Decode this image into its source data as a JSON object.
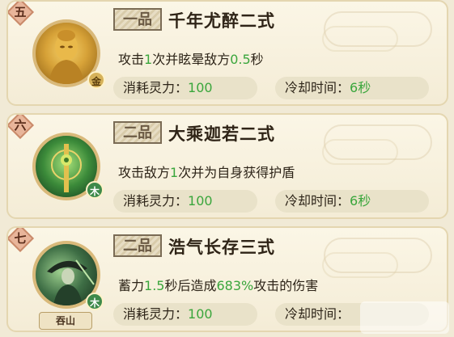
{
  "skills": [
    {
      "index": "五",
      "grade": "一品",
      "name": "千年尤醉二式",
      "desc": {
        "pre": "攻击",
        "v1": "1",
        "mid": "次并眩晕敌方",
        "v2": "0.5",
        "post": "秒"
      },
      "element": "金",
      "cost_label": "消耗灵力：",
      "cost_value": "100",
      "cd_label": "冷却时间：",
      "cd_value": "6秒"
    },
    {
      "index": "六",
      "grade": "二品",
      "name": "大乘迦若二式",
      "desc": {
        "pre": "攻击敌方",
        "v1": "1",
        "mid": "次并为自身获得护盾",
        "v2": "",
        "post": ""
      },
      "element": "木",
      "cost_label": "消耗灵力：",
      "cost_value": "100",
      "cd_label": "冷却时间：",
      "cd_value": "6秒"
    },
    {
      "index": "七",
      "grade": "二品",
      "name": "浩气长存三式",
      "desc": {
        "pre": "蓄力",
        "v1": "1.5",
        "mid": "秒后造成",
        "v2": "683%",
        "post": "攻击的伤害"
      },
      "element": "木",
      "plate": "吞山",
      "cost_label": "消耗灵力：",
      "cost_value": "100",
      "cd_label": "冷却时间：",
      "cd_value": ""
    }
  ],
  "colors": {
    "highlight": "#3aa63c",
    "card_bg": "#fbf6e6",
    "border": "#e4d6b0"
  }
}
